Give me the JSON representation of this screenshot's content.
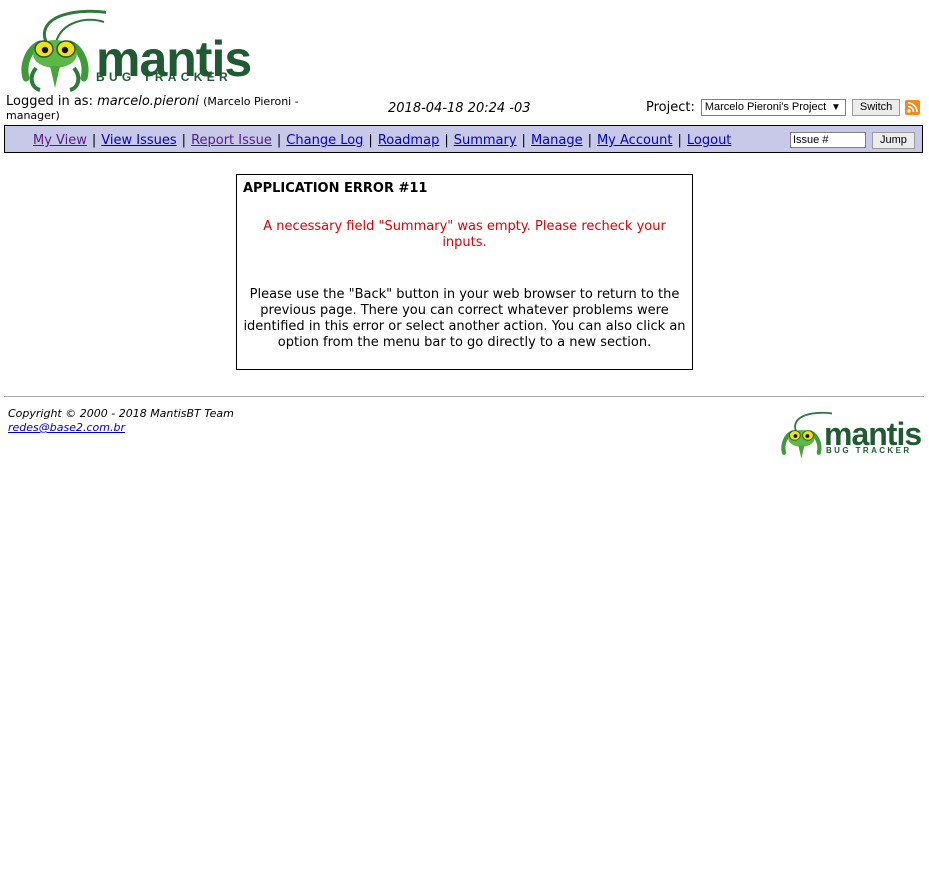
{
  "logo": {
    "word": "mantis",
    "sub": "BUG TRACKER"
  },
  "login": {
    "prefix": "Logged in as: ",
    "username": "marcelo.pieroni",
    "details_part1": "(Marcelo Pieroni -",
    "details_part2": "manager)"
  },
  "datetime": "2018-04-18 20:24 -03",
  "project": {
    "label": "Project:",
    "selected": "Marcelo Pieroni's Project",
    "switch_label": "Switch",
    "rss_icon": "rss-feed-icon"
  },
  "menu": {
    "items": [
      {
        "label": "My View"
      },
      {
        "label": "View Issues"
      },
      {
        "label": "Report Issue"
      },
      {
        "label": "Change Log"
      },
      {
        "label": "Roadmap"
      },
      {
        "label": "Summary"
      },
      {
        "label": "Manage"
      },
      {
        "label": "My Account"
      },
      {
        "label": "Logout"
      }
    ],
    "separator": "|",
    "issue_placeholder": "Issue #",
    "issue_value": "Issue #",
    "jump_label": "Jump",
    "background": "#c8c8e8"
  },
  "error": {
    "title": "APPLICATION ERROR #11",
    "message": "A necessary field \"Summary\" was empty. Please recheck your inputs.",
    "help": "Please use the \"Back\" button in your web browser to return to the previous page. There you can correct whatever problems were identified in this error or select another action. You can also click an option from the menu bar to go directly to a new section.",
    "message_color": "#dd0000"
  },
  "footer": {
    "copyright": "Copyright © 2000 - 2018 MantisBT Team",
    "email": "redes@base2.com.br",
    "logo_word": "mantis",
    "logo_sub": "BUG TRACKER"
  },
  "colors": {
    "brand_green": "#1f5a32",
    "link": "#0000cc",
    "visited": "#551a8b"
  }
}
